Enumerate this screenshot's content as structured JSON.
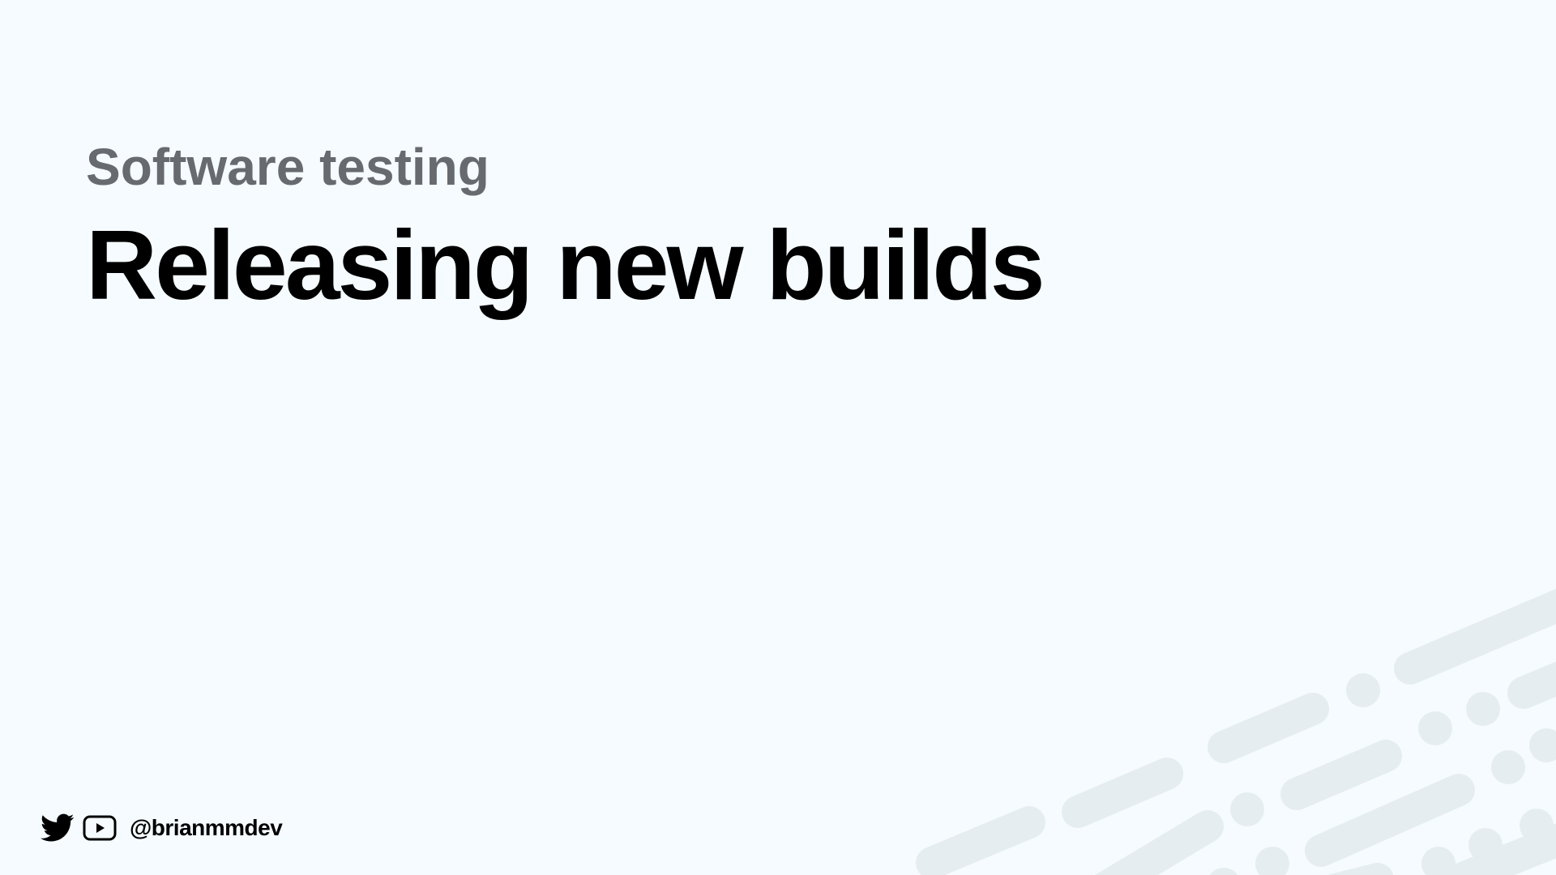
{
  "slide": {
    "subtitle": "Software testing",
    "title": "Releasing new builds"
  },
  "footer": {
    "icons": [
      "twitter-icon",
      "youtube-icon"
    ],
    "handle": "@brianmmdev"
  },
  "colors": {
    "background": "#f5fbfe",
    "subtitle": "#676a6e",
    "title": "#000000",
    "decoration": "#e6edf1"
  }
}
